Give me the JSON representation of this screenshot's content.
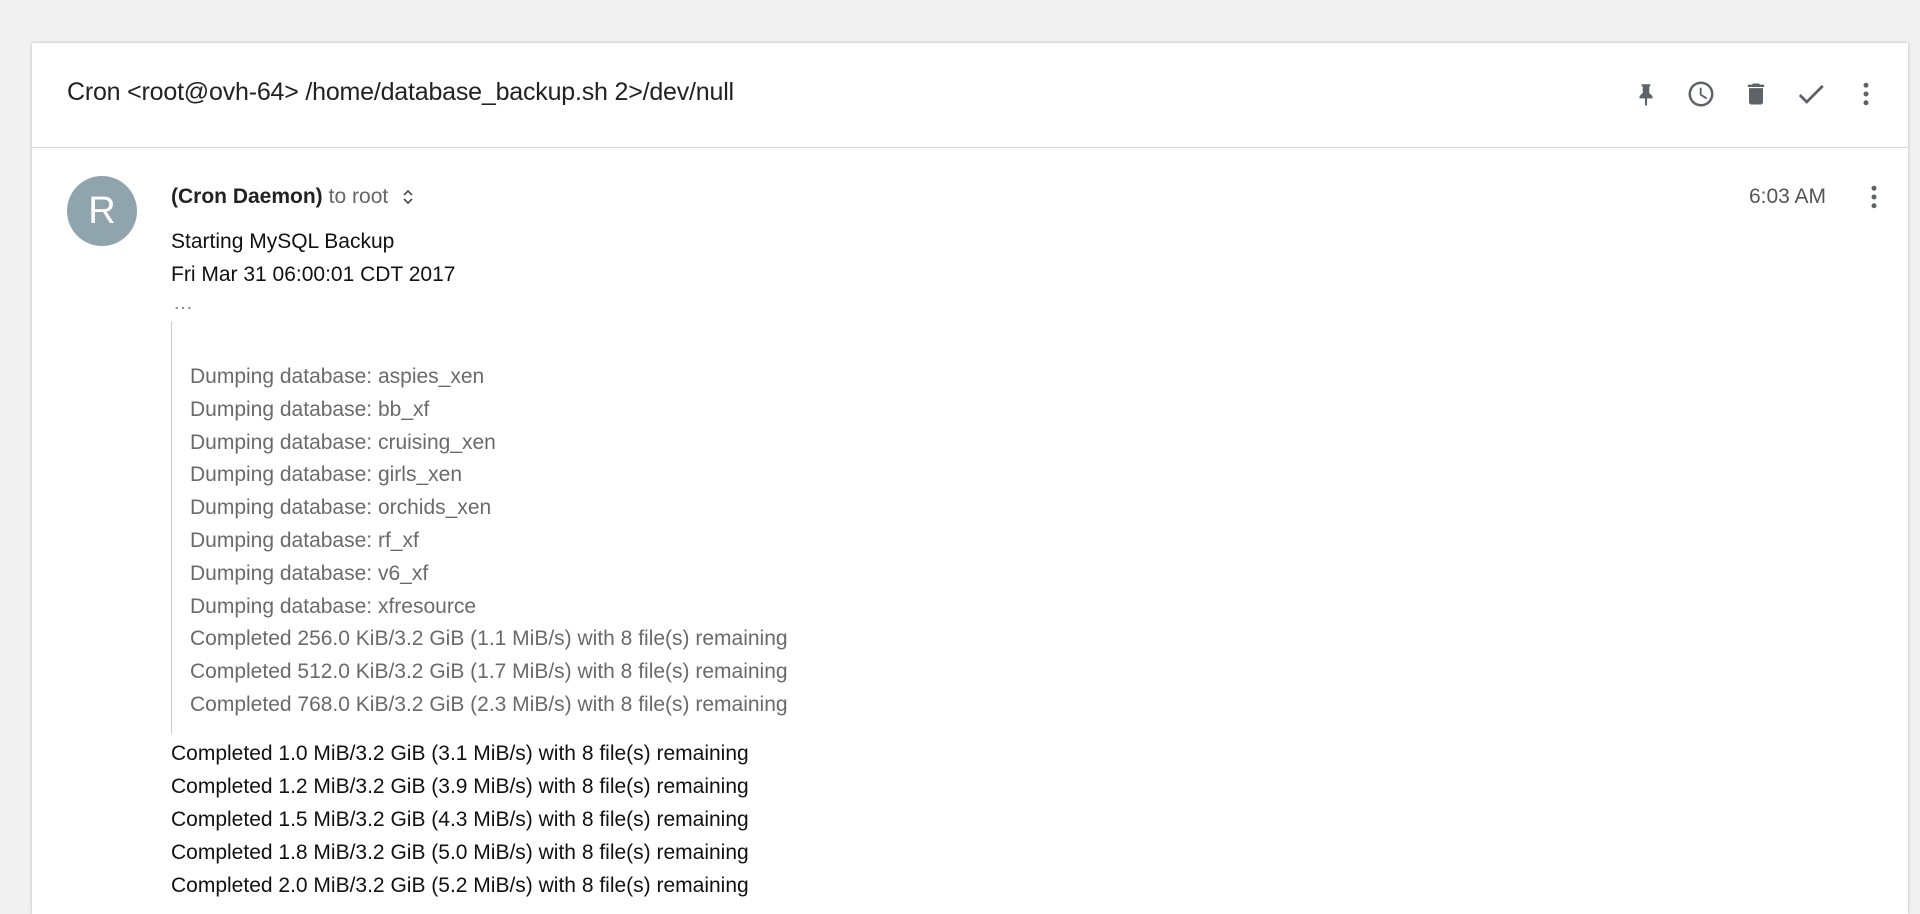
{
  "subject": "Cron <root@ovh-64> /home/database_backup.sh 2>/dev/null",
  "toolbar": {
    "icons": [
      "pin-icon",
      "snooze-clock-icon",
      "trash-icon",
      "done-check-icon",
      "more-vert-icon"
    ]
  },
  "message": {
    "avatar_letter": "R",
    "avatar_color": "#90a4ae",
    "sender": "(Cron Daemon)",
    "recipients": "to root",
    "time": "6:03 AM",
    "intro_lines": [
      "Starting MySQL Backup",
      "Fri Mar 31 06:00:01 CDT 2017"
    ],
    "ellipsis": "…",
    "quoted_lines": [
      "Dumping database: aspies_xen",
      "Dumping database: bb_xf",
      "Dumping database: cruising_xen",
      "Dumping database: girls_xen",
      "Dumping database: orchids_xen",
      "Dumping database: rf_xf",
      "Dumping database: v6_xf",
      "Dumping database: xfresource",
      "Completed 256.0 KiB/3.2 GiB (1.1 MiB/s) with 8 file(s) remaining",
      "Completed 512.0 KiB/3.2 GiB (1.7 MiB/s) with 8 file(s) remaining",
      "Completed 768.0 KiB/3.2 GiB (2.3 MiB/s) with 8 file(s) remaining"
    ],
    "after_lines": [
      "Completed 1.0 MiB/3.2 GiB (3.1 MiB/s) with 8 file(s) remaining",
      "Completed 1.2 MiB/3.2 GiB (3.9 MiB/s) with 8 file(s) remaining",
      "Completed 1.5 MiB/3.2 GiB (4.3 MiB/s) with 8 file(s) remaining",
      "Completed 1.8 MiB/3.2 GiB (5.0 MiB/s) with 8 file(s) remaining",
      "Completed 2.0 MiB/3.2 GiB (5.2 MiB/s) with 8 file(s) remaining"
    ]
  }
}
